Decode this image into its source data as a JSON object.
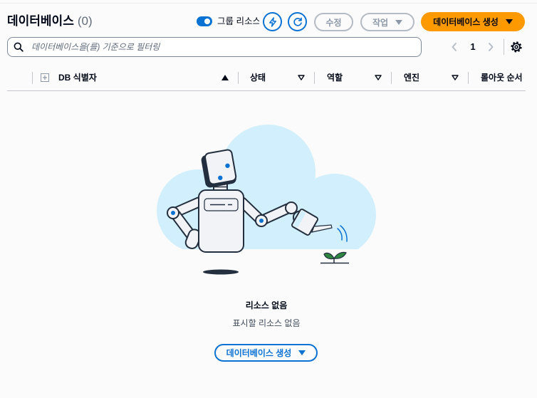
{
  "header": {
    "title": "데이터베이스",
    "count": "(0)",
    "group_toggle": {
      "label": "그룹 리소스",
      "checked": true
    },
    "edit_label": "수정",
    "actions_label": "작업",
    "create_label": "데이터베이스 생성"
  },
  "filter": {
    "placeholder": "데이터베이스을(를) 기준으로 필터링"
  },
  "pagination": {
    "current_page": "1"
  },
  "table": {
    "columns": [
      {
        "label": "DB 식별자",
        "sort_icon": "sort-ascending-icon"
      },
      {
        "label": "상태",
        "sort_icon": "sort-icon"
      },
      {
        "label": "역할",
        "sort_icon": "sort-icon"
      },
      {
        "label": "엔진",
        "sort_icon": "sort-icon"
      },
      {
        "label": "롤아웃 순서"
      }
    ],
    "rows": []
  },
  "empty_state": {
    "title": "리소스 없음",
    "message": "표시할 리소스 없음",
    "create_label": "데이터베이스 생성"
  },
  "icons": {
    "insights": "lightning-icon",
    "refresh": "refresh-icon",
    "dropdown": "caret-down-icon",
    "search": "search-icon",
    "prev_page": "chevron-left-icon",
    "next_page": "chevron-right-icon",
    "preferences": "gear-icon",
    "expand_all": "expand-icon"
  },
  "colors": {
    "accent": "#0972d3",
    "brand": "#ff9900",
    "text": "#000716",
    "text_muted": "#5f6b7a",
    "disabled": "#8d99a8",
    "disabled_border": "#b4bbc4",
    "border": "#7d8998",
    "divider": "#c6c6cd",
    "background": "#fbfbfb",
    "cloud": "#d1effc",
    "ink": "#232f3e",
    "robot": "#f2f3f7",
    "leaf": "#2e8540"
  }
}
